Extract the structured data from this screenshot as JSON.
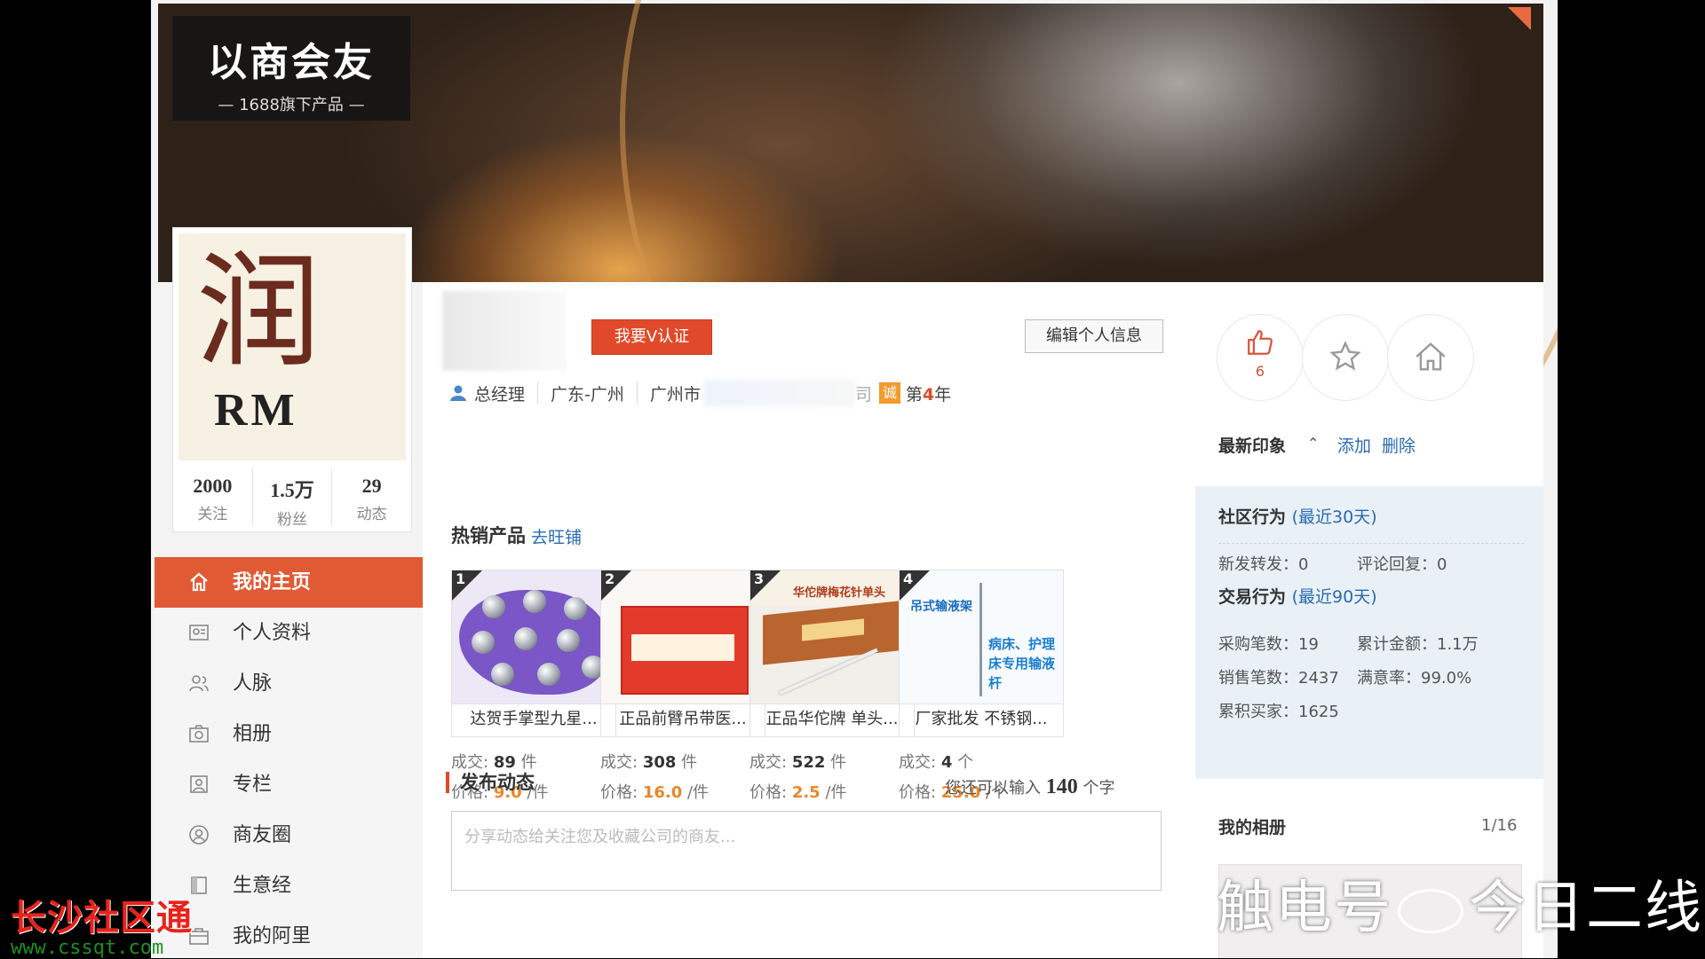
{
  "brand": {
    "logo_main": "以商会友",
    "logo_sub": "— 1688旗下产品 —"
  },
  "profile": {
    "avatar_char": "润",
    "avatar_text": "RM",
    "stats": [
      {
        "num": "2000",
        "label": "关注"
      },
      {
        "num": "1.5万",
        "label": "粉丝"
      },
      {
        "num": "29",
        "label": "动态"
      }
    ],
    "verify_button": "我要V认证",
    "edit_button": "编辑个人信息",
    "title": "总经理",
    "location": "广东-广州",
    "company_prefix": "广州市",
    "company_suffix": "司",
    "cheng_badge": "诚",
    "year_prefix": "第",
    "year_num": "4",
    "year_suffix": "年"
  },
  "sidebar": {
    "items": [
      {
        "label": "我的主页",
        "icon": "home-icon"
      },
      {
        "label": "个人资料",
        "icon": "id-card-icon"
      },
      {
        "label": "人脉",
        "icon": "people-icon"
      },
      {
        "label": "相册",
        "icon": "camera-icon"
      },
      {
        "label": "专栏",
        "icon": "column-icon"
      },
      {
        "label": "商友圈",
        "icon": "circle-user-icon"
      },
      {
        "label": "生意经",
        "icon": "book-icon"
      },
      {
        "label": "我的阿里",
        "icon": "briefcase-icon"
      }
    ]
  },
  "hot": {
    "title": "热销产品",
    "link": "去旺铺",
    "products": [
      {
        "rank": "1",
        "name": "达贺手掌型九星...",
        "sold_label": "成交:",
        "sold": "89",
        "sold_unit": "件",
        "price_label": "价格:",
        "price": "9.0",
        "price_unit": "/件"
      },
      {
        "rank": "2",
        "name": "正品前臂吊带医...",
        "sold_label": "成交:",
        "sold": "308",
        "sold_unit": "件",
        "price_label": "价格:",
        "price": "16.0",
        "price_unit": "/件"
      },
      {
        "rank": "3",
        "name": "正品华佗牌 单头...",
        "sold_label": "成交:",
        "sold": "522",
        "sold_unit": "件",
        "price_label": "价格:",
        "price": "2.5",
        "price_unit": "/件"
      },
      {
        "rank": "4",
        "name": "厂家批发 不锈钢...",
        "sold_label": "成交:",
        "sold": "4",
        "sold_unit": "个",
        "price_label": "价格:",
        "price": "25.0",
        "price_unit": "/个"
      }
    ],
    "product_art": {
      "p3_header": "华佗牌梅花针单头",
      "p4_header": "吊式输液架",
      "p4_text": "病床、护理床专用输液杆"
    }
  },
  "post": {
    "title": "发布动态",
    "count_prefix": "您还可以输入",
    "count_num": "140",
    "count_suffix": "个字",
    "placeholder": "分享动态给关注您及收藏公司的商友..."
  },
  "right": {
    "like_count": "6",
    "impression_label": "最新印象",
    "add_label": "添加",
    "delete_label": "删除",
    "community": {
      "title": "社区行为",
      "period": "(最近30天)",
      "new_forward": "新发转发：0",
      "comment_reply": "评论回复：0"
    },
    "trade": {
      "title": "交易行为",
      "period": "(最近90天)",
      "purchases": "采购笔数：19",
      "total_amount": "累计金额：1.1万",
      "sales": "销售笔数：2437",
      "satisfaction": "满意率：99.0%",
      "buyers": "累积买家：1625"
    },
    "album": {
      "title": "我的相册",
      "page": "1/16"
    }
  },
  "watermarks": {
    "left_cn": "长沙社区通",
    "left_url": "www.cssqt.com",
    "right_text_1": "触电号",
    "right_text_2": "今日二线"
  },
  "colors": {
    "accent": "#e05a33",
    "link": "#2a6ab5",
    "price": "#e8872b",
    "panel": "#e9f1f7"
  }
}
